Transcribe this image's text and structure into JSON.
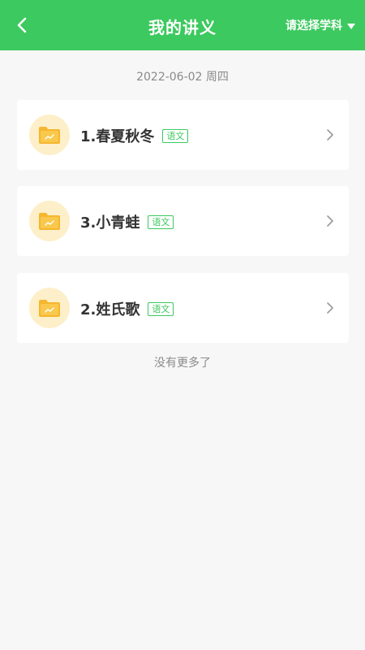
{
  "header": {
    "title": "我的讲义",
    "subject_select": "请选择学科",
    "bg_color": "#3cc95f"
  },
  "date_label": "2022-06-02 周四",
  "items": [
    {
      "label": "1.春夏秋冬",
      "tag": "语文",
      "icon": "folder-chart-icon"
    },
    {
      "label": "3.小青蛙",
      "tag": "语文",
      "icon": "folder-chart-icon"
    },
    {
      "label": "2.姓氏歌",
      "tag": "语文",
      "icon": "folder-chart-icon"
    }
  ],
  "footer_text": "没有更多了"
}
